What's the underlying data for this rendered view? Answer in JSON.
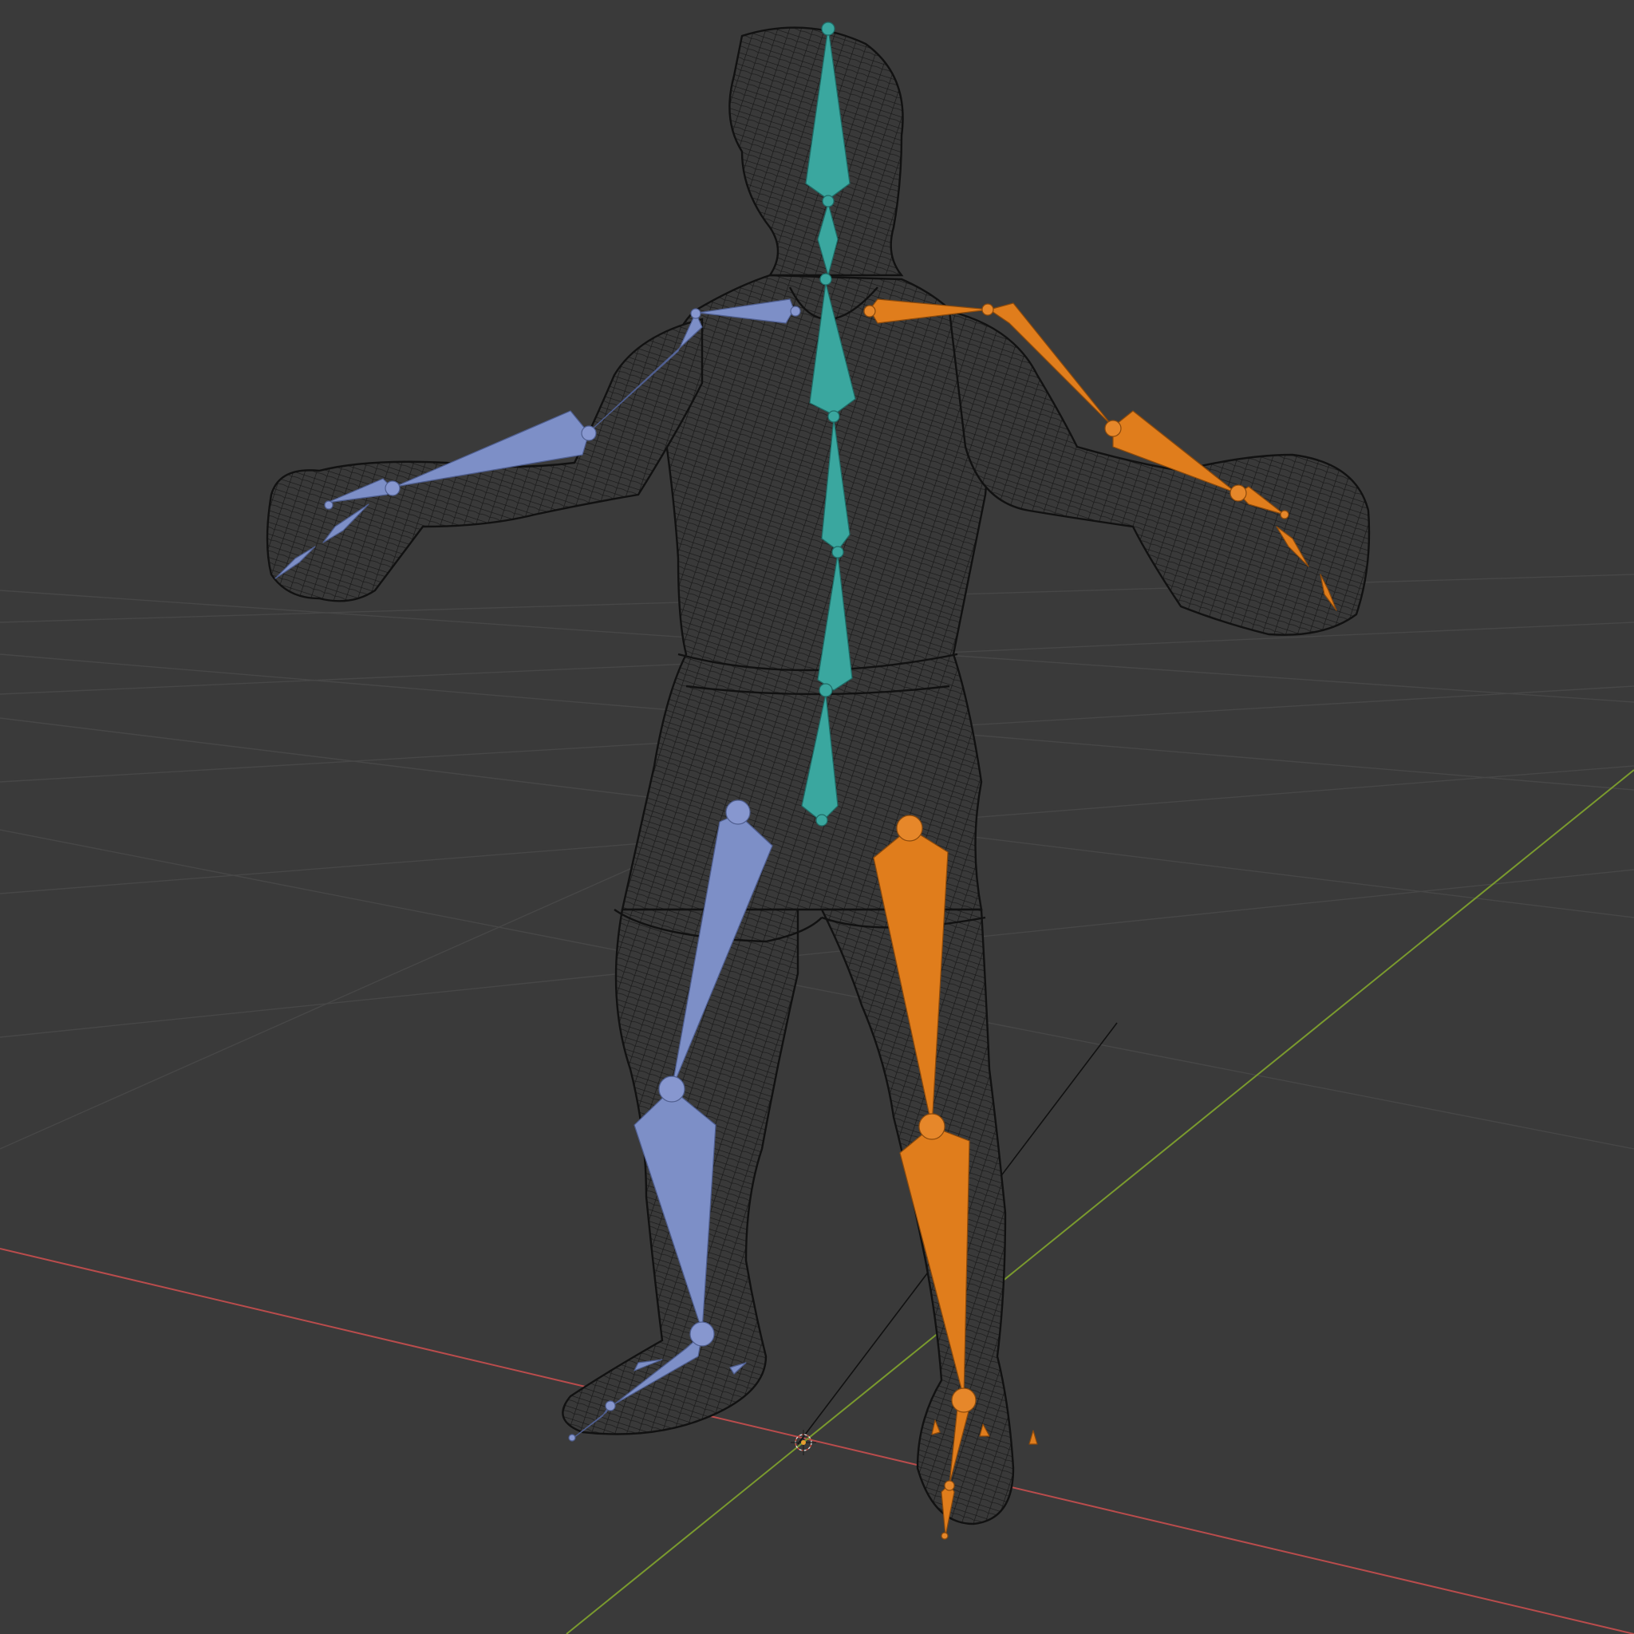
{
  "viewport": {
    "mode": "wireframe-armature",
    "background": "#3a3a3a",
    "grid_color": "#474747",
    "x_axis_color": "#b94c4c",
    "y_axis_color": "#7a9a2e",
    "bone_colors": {
      "center": "#3aa79f",
      "left": "#7d8fc7",
      "right": "#e07d1c"
    },
    "mesh_color": "#111111",
    "icons": {
      "origin": "3d-cursor-icon",
      "object": "armature-object"
    }
  }
}
